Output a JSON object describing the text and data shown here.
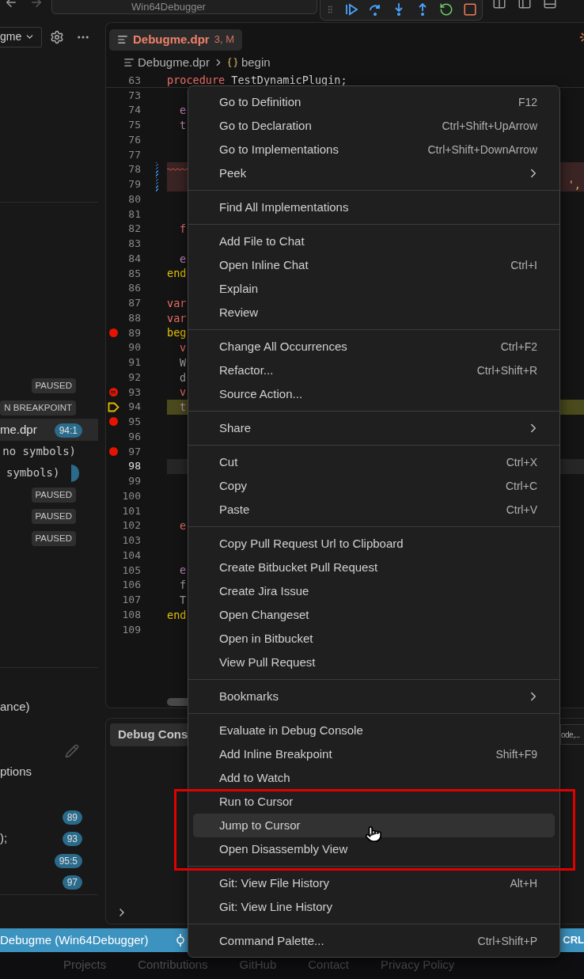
{
  "title_bar": {
    "search": "Win64Debugger"
  },
  "sidebar": {
    "dropdown": "gme",
    "call_stack": [
      {
        "kind": "status",
        "badge": "PAUSED",
        "selected": false
      },
      {
        "kind": "status",
        "badge": "N BREAKPOINT",
        "selected": false
      },
      {
        "kind": "frame",
        "label": "me.dpr",
        "badge": "94:1",
        "selected": true
      },
      {
        "kind": "module",
        "label": "no symbols)",
        "selected": false
      },
      {
        "kind": "clipped",
        "label": "symbols)",
        "selected": false
      },
      {
        "kind": "status",
        "badge": "PAUSED",
        "selected": false
      },
      {
        "kind": "status",
        "badge": "PAUSED",
        "selected": false
      },
      {
        "kind": "status",
        "badge": "PAUSED",
        "selected": false
      }
    ],
    "watch": "ance)",
    "option": "ptions",
    "breakpoints": [
      {
        "badge": "89"
      },
      {
        "label": ");",
        "badge": "93"
      },
      {
        "badge": "95:5"
      },
      {
        "badge": "97"
      }
    ]
  },
  "editor": {
    "tab": {
      "name": "Debugme.dpr",
      "status": "3, M"
    },
    "breadcrumb": {
      "file": "Debugme.dpr",
      "symbol": "begin"
    },
    "sticky": {
      "number": "63",
      "keyword": "procedure",
      "name": "TestDynamicPlugin;"
    },
    "lines": [
      {
        "number": "73",
        "kind": "plain"
      },
      {
        "number": "74",
        "kind": "plain",
        "code": {
          "text": "e",
          "kind": "control",
          "indented": true
        }
      },
      {
        "number": "75",
        "kind": "plain",
        "code": {
          "text": "t",
          "kind": "control",
          "indented": true
        }
      },
      {
        "number": "76",
        "kind": "plain"
      },
      {
        "number": "77",
        "kind": "plain"
      },
      {
        "number": "78",
        "kind": "squiggle"
      },
      {
        "number": "79",
        "kind": "error",
        "tail": "',"
      },
      {
        "number": "80",
        "kind": "plain"
      },
      {
        "number": "81",
        "kind": "plain"
      },
      {
        "number": "82",
        "kind": "plain",
        "code": {
          "text": "f",
          "kind": "keyword",
          "indented": true
        }
      },
      {
        "number": "83",
        "kind": "plain"
      },
      {
        "number": "84",
        "kind": "plain",
        "code": {
          "text": "e",
          "kind": "control",
          "indented": true
        }
      },
      {
        "number": "85",
        "kind": "plain",
        "code": {
          "text": "end",
          "kind": "block",
          "indented": false
        }
      },
      {
        "number": "86",
        "kind": "plain"
      },
      {
        "number": "87",
        "kind": "plain",
        "code": {
          "text": "var",
          "kind": "keyword",
          "indented": false
        }
      },
      {
        "number": "88",
        "kind": "plain",
        "code": {
          "text": "var",
          "kind": "keyword",
          "indented": false
        }
      },
      {
        "number": "89",
        "kind": "breakpoint",
        "code": {
          "text": "beg",
          "kind": "block",
          "indented": false
        }
      },
      {
        "number": "90",
        "kind": "plain",
        "code": {
          "text": "v",
          "kind": "keyword",
          "indented": true
        }
      },
      {
        "number": "91",
        "kind": "plain",
        "code": {
          "text": "W",
          "kind": "plain",
          "indented": true
        }
      },
      {
        "number": "92",
        "kind": "plain",
        "code": {
          "text": "d",
          "kind": "plain",
          "indented": true
        }
      },
      {
        "number": "93",
        "kind": "conditional",
        "code": {
          "text": "v",
          "kind": "keyword",
          "indented": true
        }
      },
      {
        "number": "94",
        "kind": "paused",
        "code": {
          "text": "t",
          "kind": "control",
          "indented": true
        }
      },
      {
        "number": "95",
        "kind": "breakpoint"
      },
      {
        "number": "96",
        "kind": "plain"
      },
      {
        "number": "97",
        "kind": "breakpoint"
      },
      {
        "number": "98",
        "kind": "cursor"
      },
      {
        "number": "99",
        "kind": "plain"
      },
      {
        "number": "100",
        "kind": "plain"
      },
      {
        "number": "101",
        "kind": "plain"
      },
      {
        "number": "102",
        "kind": "plain",
        "code": {
          "text": "e",
          "kind": "keyword",
          "indented": true
        }
      },
      {
        "number": "103",
        "kind": "plain"
      },
      {
        "number": "104",
        "kind": "plain"
      },
      {
        "number": "105",
        "kind": "plain",
        "code": {
          "text": "e",
          "kind": "control",
          "indented": true
        }
      },
      {
        "number": "106",
        "kind": "plain",
        "code": {
          "text": "f",
          "kind": "plain",
          "indented": true
        }
      },
      {
        "number": "107",
        "kind": "plain",
        "code": {
          "text": "T",
          "kind": "plain",
          "indented": true
        }
      },
      {
        "number": "108",
        "kind": "plain",
        "code": {
          "text": "end",
          "kind": "block",
          "indented": false
        }
      },
      {
        "number": "109",
        "kind": "plain"
      }
    ]
  },
  "panel": {
    "tab": "Debug Cons",
    "filter": "ode,..."
  },
  "status_bar": {
    "target": "Debugme (Win64Debugger)",
    "eol": "CRL"
  },
  "footer": [
    "Projects",
    "Contributions",
    "GitHub",
    "Contact",
    "Privacy Policy"
  ],
  "context_menu": {
    "groups": [
      [
        {
          "label": "Go to Definition",
          "shortcut": "F12",
          "kind": "command",
          "highlighted": false
        },
        {
          "label": "Go to Declaration",
          "shortcut": "Ctrl+Shift+UpArrow",
          "kind": "command",
          "highlighted": false
        },
        {
          "label": "Go to Implementations",
          "shortcut": "Ctrl+Shift+DownArrow",
          "kind": "command",
          "highlighted": false
        },
        {
          "label": "Peek",
          "kind": "submenu",
          "highlighted": false
        }
      ],
      [
        {
          "label": "Find All Implementations",
          "kind": "command",
          "highlighted": false
        }
      ],
      [
        {
          "label": "Add File to Chat",
          "kind": "command",
          "highlighted": false
        },
        {
          "label": "Open Inline Chat",
          "shortcut": "Ctrl+I",
          "kind": "command",
          "highlighted": false
        },
        {
          "label": "Explain",
          "kind": "command",
          "highlighted": false
        },
        {
          "label": "Review",
          "kind": "command",
          "highlighted": false
        }
      ],
      [
        {
          "label": "Change All Occurrences",
          "shortcut": "Ctrl+F2",
          "kind": "command",
          "highlighted": false
        },
        {
          "label": "Refactor...",
          "shortcut": "Ctrl+Shift+R",
          "kind": "command",
          "highlighted": false
        },
        {
          "label": "Source Action...",
          "kind": "command",
          "highlighted": false
        }
      ],
      [
        {
          "label": "Share",
          "kind": "submenu",
          "highlighted": false
        }
      ],
      [
        {
          "label": "Cut",
          "shortcut": "Ctrl+X",
          "kind": "command",
          "highlighted": false
        },
        {
          "label": "Copy",
          "shortcut": "Ctrl+C",
          "kind": "command",
          "highlighted": false
        },
        {
          "label": "Paste",
          "shortcut": "Ctrl+V",
          "kind": "command",
          "highlighted": false
        }
      ],
      [
        {
          "label": "Copy Pull Request Url to Clipboard",
          "kind": "command",
          "highlighted": false
        },
        {
          "label": "Create Bitbucket Pull Request",
          "kind": "command",
          "highlighted": false
        },
        {
          "label": "Create Jira Issue",
          "kind": "command",
          "highlighted": false
        },
        {
          "label": "Open Changeset",
          "kind": "command",
          "highlighted": false
        },
        {
          "label": "Open in Bitbucket",
          "kind": "command",
          "highlighted": false
        },
        {
          "label": "View Pull Request",
          "kind": "command",
          "highlighted": false
        }
      ],
      [
        {
          "label": "Bookmarks",
          "kind": "submenu",
          "highlighted": false
        }
      ],
      [
        {
          "label": "Evaluate in Debug Console",
          "kind": "command",
          "highlighted": false
        },
        {
          "label": "Add Inline Breakpoint",
          "shortcut": "Shift+F9",
          "kind": "command",
          "highlighted": false
        },
        {
          "label": "Add to Watch",
          "kind": "command",
          "highlighted": false
        },
        {
          "label": "Run to Cursor",
          "kind": "command",
          "highlighted": false
        },
        {
          "label": "Jump to Cursor",
          "kind": "command",
          "highlighted": true
        },
        {
          "label": "Open Disassembly View",
          "kind": "command",
          "highlighted": false
        }
      ],
      [
        {
          "label": "Git: View File History",
          "shortcut": "Alt+H",
          "kind": "command",
          "highlighted": false
        },
        {
          "label": "Git: View Line History",
          "kind": "command",
          "highlighted": false
        }
      ],
      [
        {
          "label": "Command Palette...",
          "shortcut": "Ctrl+Shift+P",
          "kind": "command",
          "highlighted": false
        }
      ]
    ]
  }
}
